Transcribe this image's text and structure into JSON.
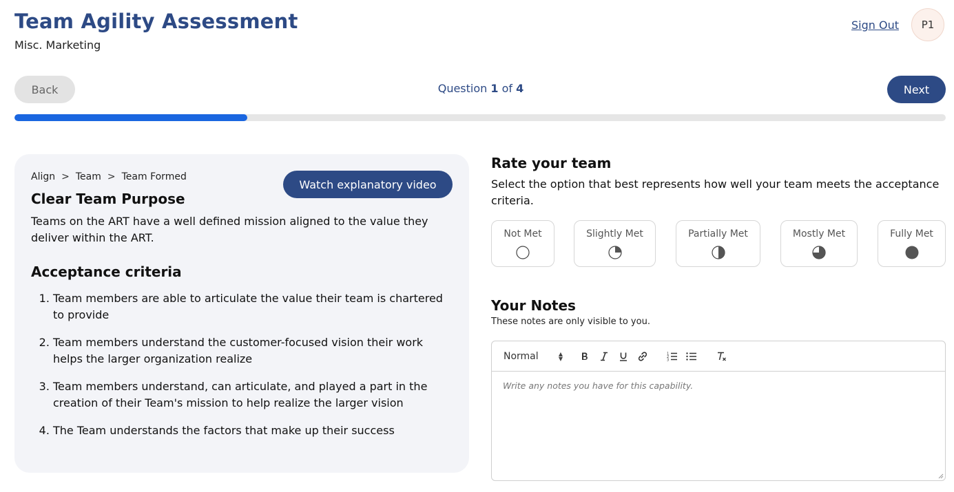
{
  "header": {
    "title": "Team Agility Assessment",
    "subtitle": "Misc. Marketing",
    "sign_out": "Sign Out",
    "avatar_initials": "P1"
  },
  "navigation": {
    "back_label": "Back",
    "next_label": "Next",
    "question_prefix": "Question",
    "question_current": "1",
    "question_of": "of",
    "question_total": "4",
    "progress_fraction": 0.25
  },
  "capability": {
    "breadcrumb": [
      "Align",
      "Team",
      "Team Formed"
    ],
    "breadcrumb_separator": ">",
    "video_button": "Watch explanatory video",
    "title": "Clear Team Purpose",
    "description": "Teams on the ART have a well defined mission aligned to the value they deliver within the ART.",
    "criteria_heading": "Acceptance criteria",
    "criteria": [
      "Team members are able to articulate the value their team is chartered to provide",
      "Team members understand the customer-focused vision their work helps the larger organization realize",
      "Team members understand, can articulate, and played a part in the creation of their Team's mission to help realize the larger vision",
      "The Team understands the factors that make up their success"
    ]
  },
  "rating": {
    "heading": "Rate your team",
    "instructions": "Select the option that best represents how well your team meets the acceptance criteria.",
    "options": [
      {
        "label": "Not Met",
        "fill": 0
      },
      {
        "label": "Slightly Met",
        "fill": 0.25
      },
      {
        "label": "Partially Met",
        "fill": 0.5
      },
      {
        "label": "Mostly Met",
        "fill": 0.75
      },
      {
        "label": "Fully Met",
        "fill": 1
      }
    ]
  },
  "notes": {
    "heading": "Your Notes",
    "subtitle": "These notes are only visible to you.",
    "format_value": "Normal",
    "placeholder": "Write any notes you have for this capability.",
    "toolbar_icons": [
      "bold-icon",
      "italic-icon",
      "underline-icon",
      "link-icon",
      "ordered-list-icon",
      "bullet-list-icon",
      "clear-format-icon"
    ]
  },
  "colors": {
    "primary": "#2d4a85",
    "progress": "#1a66e0",
    "card_bg": "#f3f4f8"
  }
}
